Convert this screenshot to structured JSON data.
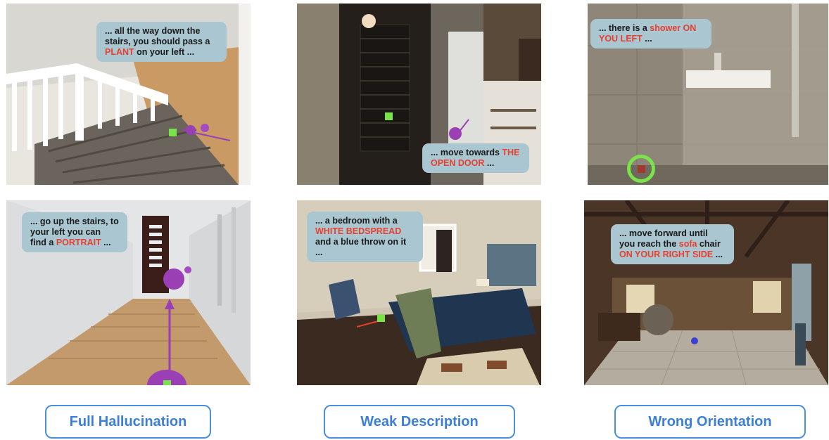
{
  "panels": [
    {
      "name": "stairs-down",
      "caption_parts": [
        "... all the way down the stairs, you should pass a ",
        "PLANT",
        " on your left ..."
      ]
    },
    {
      "name": "cellar-door",
      "caption_parts": [
        "... move towards ",
        "THE OPEN DOOR",
        " ..."
      ]
    },
    {
      "name": "bathroom-shower",
      "caption_parts": [
        "... there is a ",
        "shower ON YOU LEFT",
        " ..."
      ]
    },
    {
      "name": "hallway-up",
      "caption_parts": [
        "... go up the stairs, to your left you can find a ",
        "PORTRAIT",
        " ..."
      ]
    },
    {
      "name": "bedroom",
      "caption_parts": [
        "... a bedroom with a ",
        "WHITE BEDSPREAD",
        " and a blue throw on it ..."
      ]
    },
    {
      "name": "barn-living-room",
      "caption_parts": [
        "... move forward until you reach the ",
        "sofa",
        " chair ",
        "ON YOUR RIGHT SIDE",
        " ..."
      ]
    }
  ],
  "labels": {
    "full_hallucination": "Full Hallucination",
    "weak_description": "Weak Description",
    "wrong_orientation": "Wrong Orientation"
  },
  "colors": {
    "bubble": "#a9c6d1",
    "highlight": "#e8402e",
    "label_border": "#4a8ee0",
    "marker": "#7be34a",
    "path": "#9b3fb5"
  }
}
